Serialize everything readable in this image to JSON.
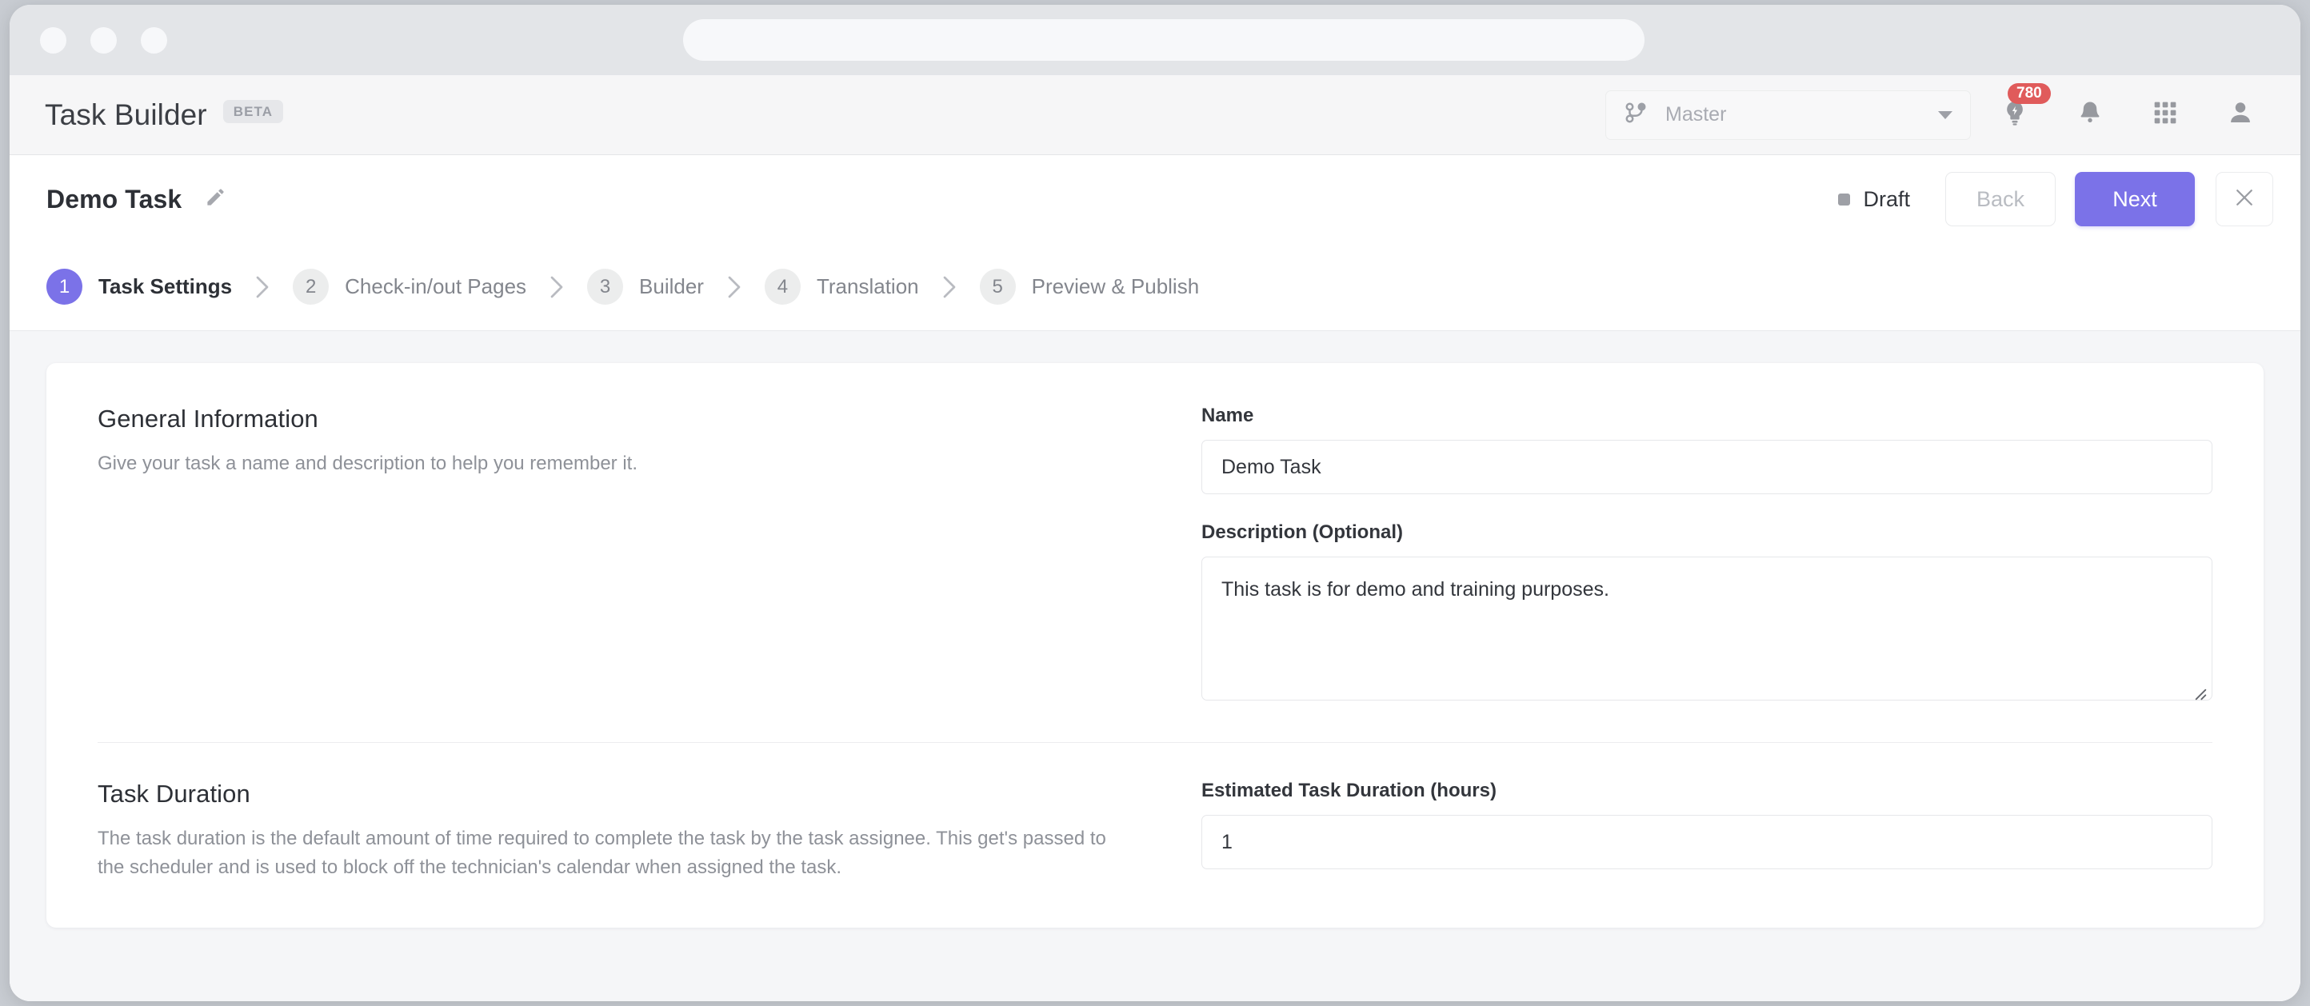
{
  "browser": {
    "traffic_lights": [
      "close",
      "minimize",
      "maximize"
    ],
    "url_value": "",
    "url_placeholder": ""
  },
  "appbar": {
    "title": "Task Builder",
    "beta_badge": "BETA",
    "branch_selector": {
      "icon": "branch-icon",
      "value": "Master"
    },
    "icons": [
      {
        "name": "lightbulb-idea-icon",
        "badge": "780"
      },
      {
        "name": "bell-notifications-icon",
        "badge": ""
      },
      {
        "name": "apps-grid-icon",
        "badge": ""
      },
      {
        "name": "user-account-icon",
        "badge": ""
      }
    ]
  },
  "task_header": {
    "task_name": "Demo Task",
    "edit_icon": "pencil-edit-icon",
    "status": "Draft",
    "back_label": "Back",
    "next_label": "Next",
    "close_icon": "close-x-icon"
  },
  "stepper": {
    "steps": [
      {
        "number": "1",
        "label": "Task Settings",
        "active": true
      },
      {
        "number": "2",
        "label": "Check-in/out Pages",
        "active": false
      },
      {
        "number": "3",
        "label": "Builder",
        "active": false
      },
      {
        "number": "4",
        "label": "Translation",
        "active": false
      },
      {
        "number": "5",
        "label": "Preview & Publish",
        "active": false
      }
    ]
  },
  "general_information": {
    "title": "General Information",
    "description": "Give your task a name and description to help you remember it.",
    "name_label": "Name",
    "name_value": "Demo Task",
    "description_label": "Description (Optional)",
    "description_value": "This task is for demo and training purposes."
  },
  "task_duration": {
    "title": "Task Duration",
    "description": "The task duration is the default amount of time required to complete the task by the task assignee. This get's passed to the scheduler and is used to block off the technician's calendar when assigned the task.",
    "duration_label": "Estimated Task Duration (hours)",
    "duration_value": "1"
  },
  "colors": {
    "accent_purple": "#7b72e8",
    "badge_red": "#e05b5b",
    "page_bg": "#f5f6f8",
    "text_primary": "#2d3036",
    "text_muted": "#8e9198"
  }
}
